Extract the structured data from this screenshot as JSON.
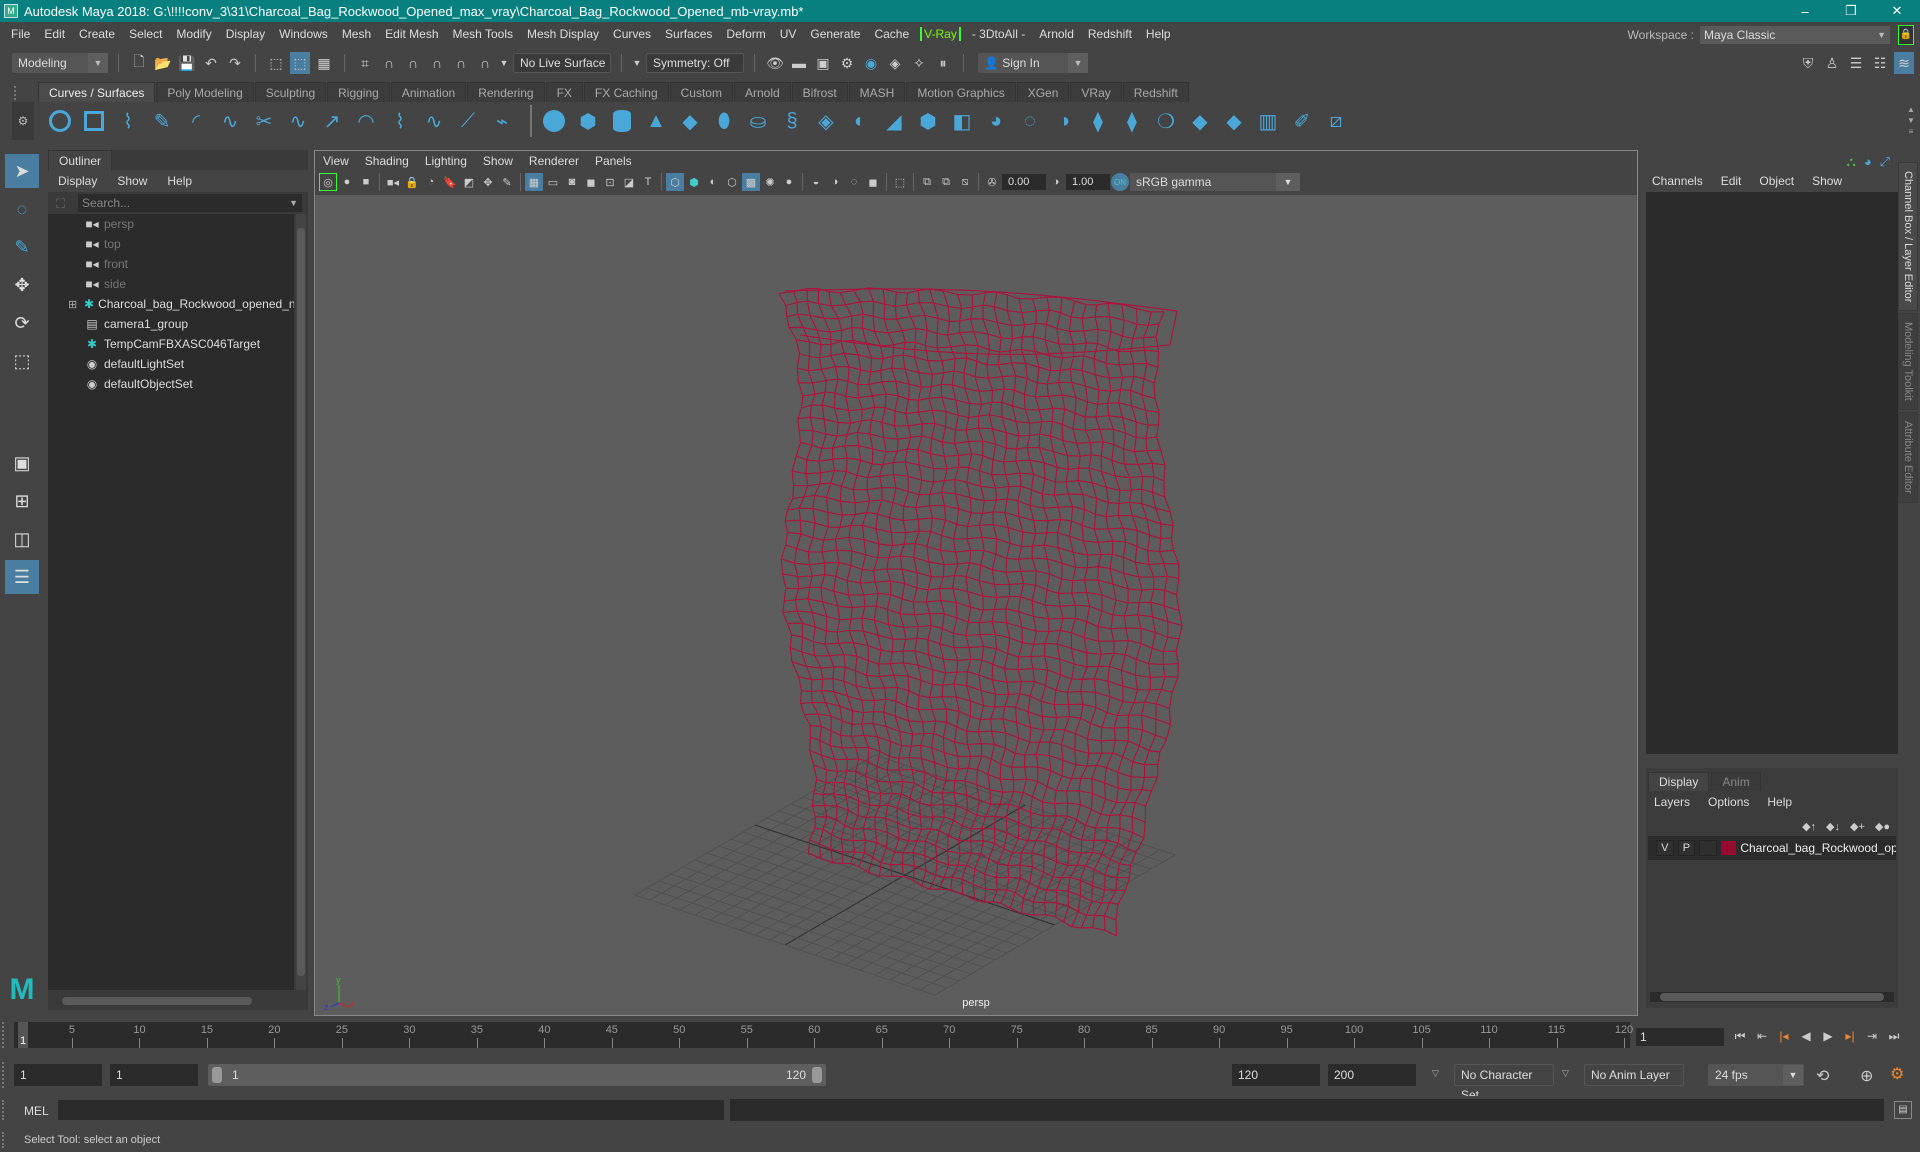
{
  "window": {
    "title": "Autodesk Maya 2018: G:\\!!!!conv_3\\31\\Charcoal_Bag_Rockwood_Opened_max_vray\\Charcoal_Bag_Rockwood_Opened_mb-vray.mb*",
    "minimize": "–",
    "maximize": "❐",
    "close": "✕"
  },
  "menubar": {
    "items": [
      "File",
      "Edit",
      "Create",
      "Select",
      "Modify",
      "Display",
      "Windows",
      "Mesh",
      "Edit Mesh",
      "Mesh Tools",
      "Mesh Display",
      "Curves",
      "Surfaces",
      "Deform",
      "UV",
      "Generate",
      "Cache"
    ],
    "vray": "V-Ray",
    "items_after": [
      "- 3DtoAll -",
      "Arnold",
      "Redshift",
      "Help"
    ],
    "workspace_label": "Workspace :",
    "workspace_value": "Maya Classic"
  },
  "statusline": {
    "mode": "Modeling",
    "live_surface": "No Live Surface",
    "symmetry": "Symmetry: Off",
    "sign_in": "Sign In"
  },
  "shelf": {
    "tabs": [
      "Curves / Surfaces",
      "Poly Modeling",
      "Sculpting",
      "Rigging",
      "Animation",
      "Rendering",
      "FX",
      "FX Caching",
      "Custom",
      "Arnold",
      "Bifrost",
      "MASH",
      "Motion Graphics",
      "XGen",
      "VRay",
      "Redshift"
    ],
    "active_tab": "Curves / Surfaces"
  },
  "outliner": {
    "title": "Outliner",
    "menu": [
      "Display",
      "Show",
      "Help"
    ],
    "search_placeholder": "Search...",
    "items": [
      {
        "label": "persp",
        "icon": "camera-icon",
        "dim": true
      },
      {
        "label": "top",
        "icon": "camera-icon",
        "dim": true
      },
      {
        "label": "front",
        "icon": "camera-icon",
        "dim": true
      },
      {
        "label": "side",
        "icon": "camera-icon",
        "dim": true
      },
      {
        "label": "Charcoal_bag_Rockwood_opened_nc",
        "icon": "locator-icon",
        "expandable": true
      },
      {
        "label": "camera1_group",
        "icon": "group-icon"
      },
      {
        "label": "TempCamFBXASC046Target",
        "icon": "locator-icon"
      },
      {
        "label": "defaultLightSet",
        "icon": "set-icon"
      },
      {
        "label": "defaultObjectSet",
        "icon": "set-icon"
      }
    ]
  },
  "viewport": {
    "menu": [
      "View",
      "Shading",
      "Lighting",
      "Show",
      "Renderer",
      "Panels"
    ],
    "exposure": "0.00",
    "gamma": "1.00",
    "color_space": "sRGB gamma",
    "camera_label": "persp",
    "wireframe_color": "#b0103c",
    "axis": {
      "x": "x",
      "y": "y",
      "z": "z"
    }
  },
  "channelbox": {
    "menu": [
      "Channels",
      "Edit",
      "Object",
      "Show"
    ],
    "side_tabs": [
      "Channel Box / Layer Editor",
      "Modeling Toolkit",
      "Attribute Editor"
    ]
  },
  "layer_editor": {
    "tabs": [
      "Display",
      "Anim"
    ],
    "menu": [
      "Layers",
      "Options",
      "Help"
    ],
    "layer": {
      "v": "V",
      "p": "P",
      "name": "Charcoal_bag_Rockwood_opened",
      "color": "#9a0a30"
    }
  },
  "timeline": {
    "ticks": [
      5,
      10,
      15,
      20,
      25,
      30,
      35,
      40,
      45,
      50,
      55,
      60,
      65,
      70,
      75,
      80,
      85,
      90,
      95,
      100,
      105,
      110,
      115,
      120
    ],
    "start": 1,
    "end": 120,
    "current_frame": "1",
    "current_field": "1"
  },
  "range": {
    "start_field": "1",
    "playback_start": "1",
    "slider_start": "1",
    "slider_end": "120",
    "playback_end": "120",
    "end_field": "200",
    "character_set": "No Character Set",
    "anim_layer": "No Anim Layer",
    "fps": "24 fps"
  },
  "cmdline": {
    "label": "MEL"
  },
  "helpline": {
    "text": "Select Tool: select an object"
  }
}
